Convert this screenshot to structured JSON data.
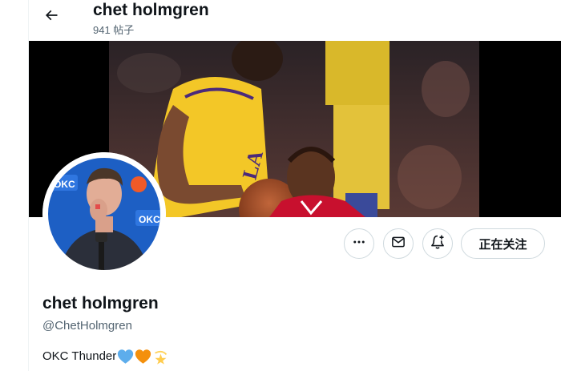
{
  "header": {
    "name": "chet holmgren",
    "post_count": "941 帖子"
  },
  "profile": {
    "name": "chet holmgren",
    "handle": "@ChetHolmgren",
    "bio_text": "OKC Thunder",
    "bio_emojis": [
      "blue-heart",
      "orange-heart",
      "dizzy-star"
    ]
  },
  "actions": {
    "more_icon": "more-dots-icon",
    "message_icon": "mail-icon",
    "notify_icon": "bell-plus-icon",
    "follow_label": "正在关注"
  },
  "colors": {
    "text_primary": "#0f1419",
    "text_secondary": "#536471",
    "border": "#cfd9de",
    "heart_blue": "#5dadec",
    "heart_orange": "#f4900c",
    "star_yellow": "#ffcc4d"
  }
}
